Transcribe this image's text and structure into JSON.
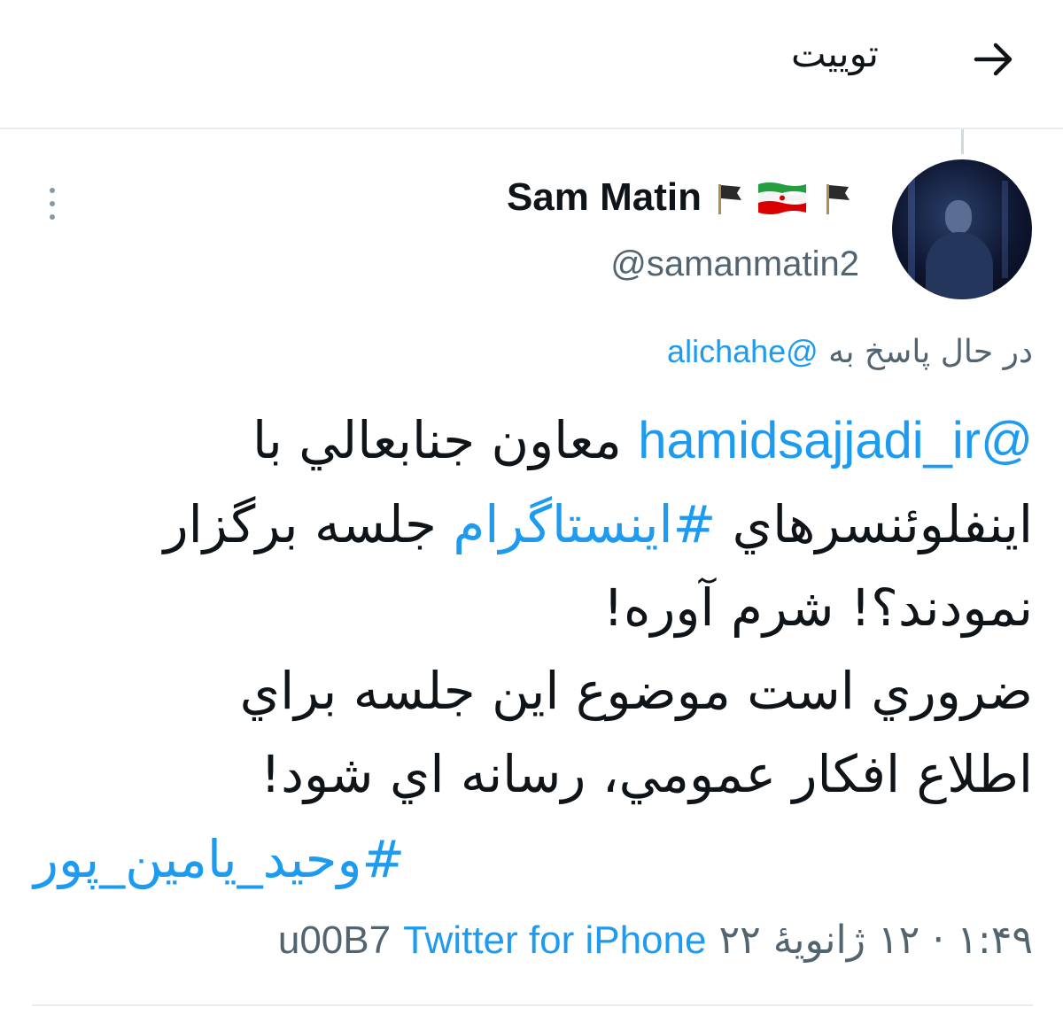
{
  "header": {
    "title": "تویيت",
    "back_icon": "arrow-right-icon"
  },
  "user": {
    "display_name": "Sam Matin",
    "handle": "@samanmatin2"
  },
  "tweet": {
    "reply_prefix": "در حال پاسخ به",
    "reply_to": "@alichahe",
    "lines": [
      {
        "mention": "@hamidsajjadi_ir",
        "text": " معاون جنابعالي با"
      },
      {
        "pre": "اينفلوئنسرهاي ",
        "hashtag": "#اينستاگرام",
        "post": " جلسه برگزار"
      },
      {
        "text": "نمودند؟! شرم آوره!"
      },
      {
        "text": "ضروري است موضوع اين جلسه براي"
      },
      {
        "text": "اطلاع افكار عمومي، رسانه اي شود!"
      }
    ],
    "hashtag_line": "#وحيد_يامين_پور",
    "time": "۱:۴۹",
    "separator": "·",
    "date": "۱۲ ژانویهٔ ۲۲",
    "source_prefix": "u00B7",
    "source": "Twitter for iPhone"
  },
  "colors": {
    "link": "#1d9bf0",
    "muted": "#536471",
    "text": "#0f1419",
    "divider": "#e9ecef"
  }
}
